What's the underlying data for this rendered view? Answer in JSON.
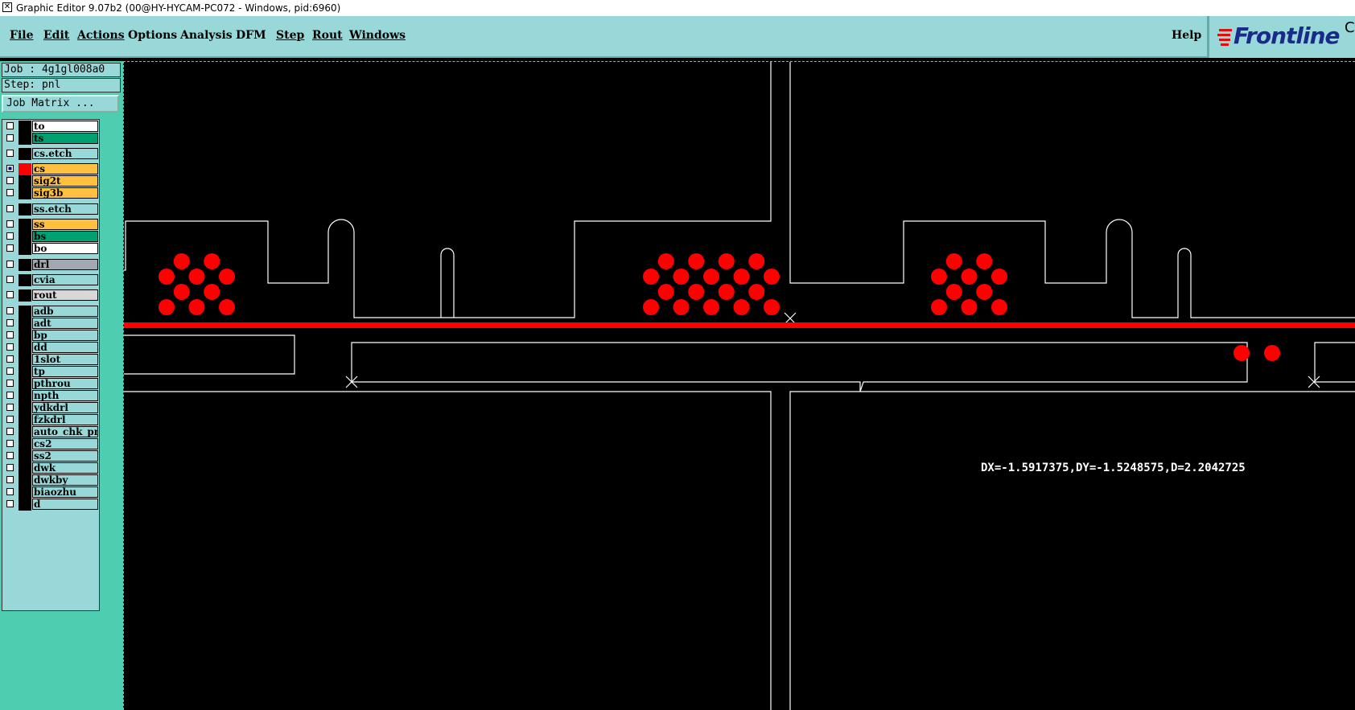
{
  "window": {
    "title": "Graphic Editor 9.07b2 (00@HY-HYCAM-PC072 - Windows, pid:6960)"
  },
  "menu": {
    "items": [
      {
        "label": "File"
      },
      {
        "label": "Edit"
      },
      {
        "label": "Actions"
      },
      {
        "label": "Options"
      },
      {
        "label": "Analysis"
      },
      {
        "label": "DFM"
      },
      {
        "label": "Step"
      },
      {
        "label": "Rout"
      },
      {
        "label": "Windows"
      }
    ],
    "help": "Help"
  },
  "logo": {
    "text": "Frontline",
    "edge_char": "C",
    "color": "#1a2a8a",
    "mark_color": "#e01010"
  },
  "job": {
    "label": "Job : 4g1gl008a0",
    "step": "Step: pnl",
    "matrix_button": "Job Matrix ..."
  },
  "layers": [
    {
      "name": "to",
      "color": "#ffffff",
      "checked": false
    },
    {
      "name": "ts",
      "color": "#00a070",
      "checked": false
    },
    {
      "name": "cs.etch",
      "color": "#99d8d8",
      "checked": false
    },
    {
      "name": "cs",
      "color": "#ffc040",
      "checked": true,
      "active_color": "#ff0000"
    },
    {
      "name": "sig2t",
      "color": "#ffc040",
      "checked": false
    },
    {
      "name": "sig3b",
      "color": "#ffc040",
      "checked": false
    },
    {
      "name": "ss.etch",
      "color": "#99d8d8",
      "checked": false
    },
    {
      "name": "ss",
      "color": "#ffc040",
      "checked": false
    },
    {
      "name": "bs",
      "color": "#00a070",
      "checked": false
    },
    {
      "name": "bo",
      "color": "#ffffff",
      "checked": false
    },
    {
      "name": "drl",
      "color": "#a0a8b0",
      "checked": false
    },
    {
      "name": "cvia",
      "color": "#99d8d8",
      "checked": false
    },
    {
      "name": "rout",
      "color": "#d8d8d8",
      "checked": false
    },
    {
      "name": "adb",
      "color": "#99d8d8",
      "checked": false
    },
    {
      "name": "adt",
      "color": "#99d8d8",
      "checked": false
    },
    {
      "name": "bp",
      "color": "#99d8d8",
      "checked": false
    },
    {
      "name": "dd",
      "color": "#99d8d8",
      "checked": false
    },
    {
      "name": "1slot",
      "color": "#99d8d8",
      "checked": false
    },
    {
      "name": "tp",
      "color": "#99d8d8",
      "checked": false
    },
    {
      "name": "pthrou",
      "color": "#99d8d8",
      "checked": false
    },
    {
      "name": "npth",
      "color": "#99d8d8",
      "checked": false
    },
    {
      "name": "ydkdrl",
      "color": "#99d8d8",
      "checked": false
    },
    {
      "name": "fzkdrl",
      "color": "#99d8d8",
      "checked": false
    },
    {
      "name": "auto_chk_pn",
      "color": "#99d8d8",
      "checked": false
    },
    {
      "name": "cs2",
      "color": "#99d8d8",
      "checked": false
    },
    {
      "name": "ss2",
      "color": "#99d8d8",
      "checked": false
    },
    {
      "name": "dwk",
      "color": "#99d8d8",
      "checked": false
    },
    {
      "name": "dwkby",
      "color": "#99d8d8",
      "checked": false
    },
    {
      "name": "biaozhu",
      "color": "#99d8d8",
      "checked": false
    },
    {
      "name": "d",
      "color": "#99d8d8",
      "checked": false
    }
  ],
  "canvas": {
    "measurement": "DX=-1.5917375,DY=-1.5248575,D=2.2042725",
    "feature_color": "#ff0000",
    "outline_color": "#ffffff"
  }
}
